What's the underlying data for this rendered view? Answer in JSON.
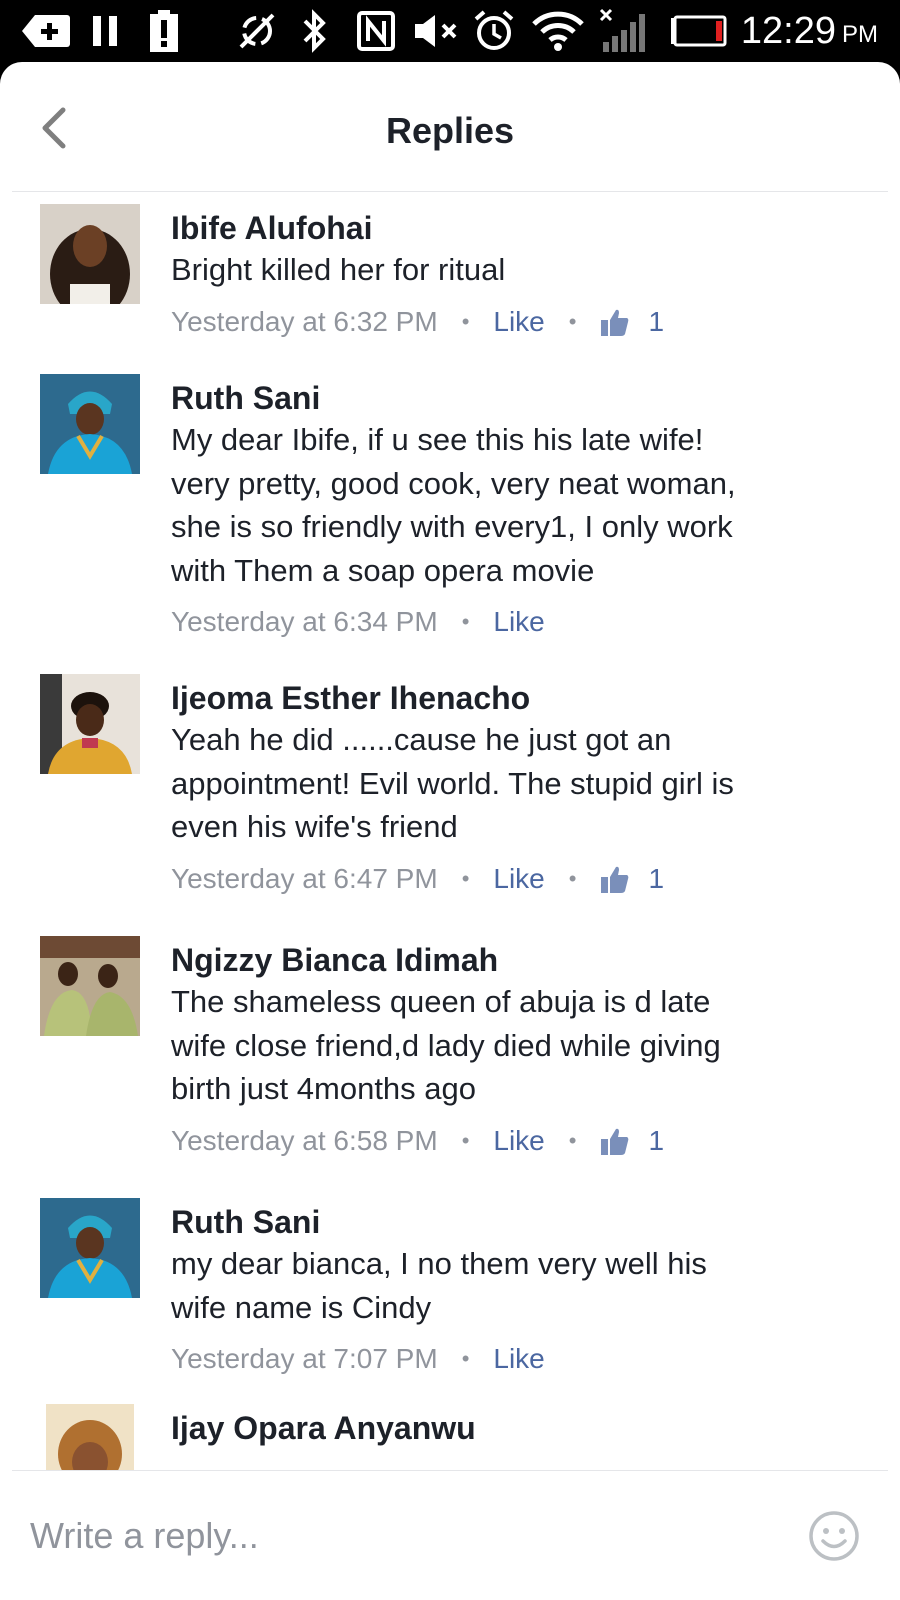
{
  "status_bar": {
    "time": "12:29",
    "ampm": "PM",
    "icons": [
      "plus-notification-icon",
      "pause-icon",
      "alert-icon",
      "sync-off-icon",
      "bluetooth-icon",
      "nfc-icon",
      "mute-icon",
      "alarm-icon",
      "wifi-icon",
      "signal-icon",
      "battery-low-icon"
    ],
    "battery_color": "#e02020"
  },
  "header": {
    "title": "Replies"
  },
  "replies": [
    {
      "author": "Ibife Alufohai",
      "lines": [
        "Bright killed her for ritual"
      ],
      "time": "Yesterday at 6:32 PM",
      "like_label": "Like",
      "like_count": "1"
    },
    {
      "author": "Ruth Sani",
      "lines": [
        "My dear Ibife, if u see this his late wife!",
        "very pretty, good cook, very neat woman,",
        "she is so friendly with every1, I only work",
        "with Them a soap opera movie"
      ],
      "time": "Yesterday at 6:34 PM",
      "like_label": "Like"
    },
    {
      "author": "Ijeoma Esther Ihenacho",
      "lines": [
        "Yeah he did ......cause he just got an",
        "appointment! Evil world. The stupid girl is",
        "even his wife's friend"
      ],
      "time": "Yesterday at 6:47 PM",
      "like_label": "Like",
      "like_count": "1"
    },
    {
      "author": "Ngizzy Bianca Idimah",
      "lines": [
        "The shameless queen of abuja is d late",
        "wife close friend,d lady died while giving",
        "birth just 4months ago"
      ],
      "time": "Yesterday at 6:58 PM",
      "like_label": "Like",
      "like_count": "1"
    },
    {
      "author": "Ruth Sani",
      "lines": [
        "my dear bianca, I no them very well his",
        "wife name is Cindy"
      ],
      "time": "Yesterday at 7:07 PM",
      "like_label": "Like"
    },
    {
      "author": "Ijay Opara Anyanwu"
    }
  ],
  "footer": {
    "placeholder": "Write a reply..."
  },
  "colors": {
    "text": "#1d2129",
    "meta": "#90949c",
    "link": "#4b67a1",
    "divider": "#e5e6e9"
  }
}
